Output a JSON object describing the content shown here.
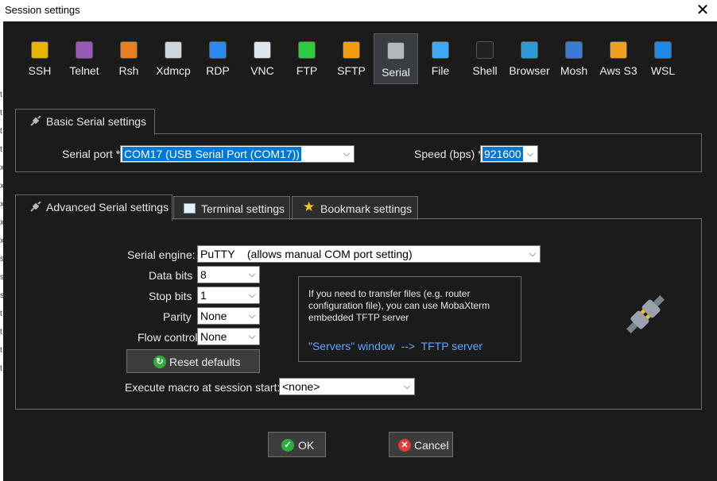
{
  "window": {
    "title": "Session settings",
    "close_symbol": "✕"
  },
  "left_edge_chars": [
    "t",
    "t",
    "t",
    "t",
    "x",
    "x",
    "x",
    "x",
    "x",
    "s",
    "s",
    "s",
    "t",
    "t",
    "t",
    "t"
  ],
  "toolbar": [
    {
      "label": "SSH",
      "icon": "ssh-icon",
      "color": "#e8b400"
    },
    {
      "label": "Telnet",
      "icon": "telnet-icon",
      "color": "#9b59b6"
    },
    {
      "label": "Rsh",
      "icon": "rsh-icon",
      "color": "#e67e22"
    },
    {
      "label": "Xdmcp",
      "icon": "xdmcp-icon",
      "color": "#cfd8dc"
    },
    {
      "label": "RDP",
      "icon": "rdp-icon",
      "color": "#2d89ef"
    },
    {
      "label": "VNC",
      "icon": "vnc-icon",
      "color": "#dfe6ee"
    },
    {
      "label": "FTP",
      "icon": "ftp-icon",
      "color": "#2ecc40"
    },
    {
      "label": "SFTP",
      "icon": "sftp-icon",
      "color": "#f39c12"
    },
    {
      "label": "Serial",
      "icon": "serial-icon",
      "color": "#b0b8c0"
    },
    {
      "label": "File",
      "icon": "file-icon",
      "color": "#3fa9f5"
    },
    {
      "label": "Shell",
      "icon": "shell-icon",
      "color": "#222222"
    },
    {
      "label": "Browser",
      "icon": "browser-icon",
      "color": "#2f9bd6"
    },
    {
      "label": "Mosh",
      "icon": "mosh-icon",
      "color": "#3a7bd5"
    },
    {
      "label": "Aws S3",
      "icon": "aws-s3-icon",
      "color": "#f0a020"
    },
    {
      "label": "WSL",
      "icon": "wsl-icon",
      "color": "#1e88e5"
    }
  ],
  "basic": {
    "tab_label": "Basic Serial settings",
    "serial_port_label": "Serial port *",
    "serial_port_value": "COM17  (USB Serial Port (COM17))",
    "speed_label": "Speed (bps) *",
    "speed_value": "921600"
  },
  "tabs": {
    "advanced": "Advanced Serial settings",
    "terminal": "Terminal settings",
    "bookmark": "Bookmark settings"
  },
  "advanced": {
    "engine_label": "Serial engine:",
    "engine_value": "PuTTY    (allows manual COM port setting)",
    "data_bits_label": "Data bits",
    "data_bits_value": "8",
    "stop_bits_label": "Stop bits",
    "stop_bits_value": "1",
    "parity_label": "Parity",
    "parity_value": "None",
    "flow_label": "Flow control",
    "flow_value": "None",
    "reset_label": "Reset defaults",
    "macro_label": "Execute macro at session start:",
    "macro_value": "<none>",
    "info_text": "If you need to transfer files (e.g. router configuration file), you can use MobaXterm embedded TFTP server",
    "info_link": "\"Servers\" window  -->  TFTP server"
  },
  "buttons": {
    "ok": "OK",
    "cancel": "Cancel"
  },
  "arrow_glyph": "⌵"
}
